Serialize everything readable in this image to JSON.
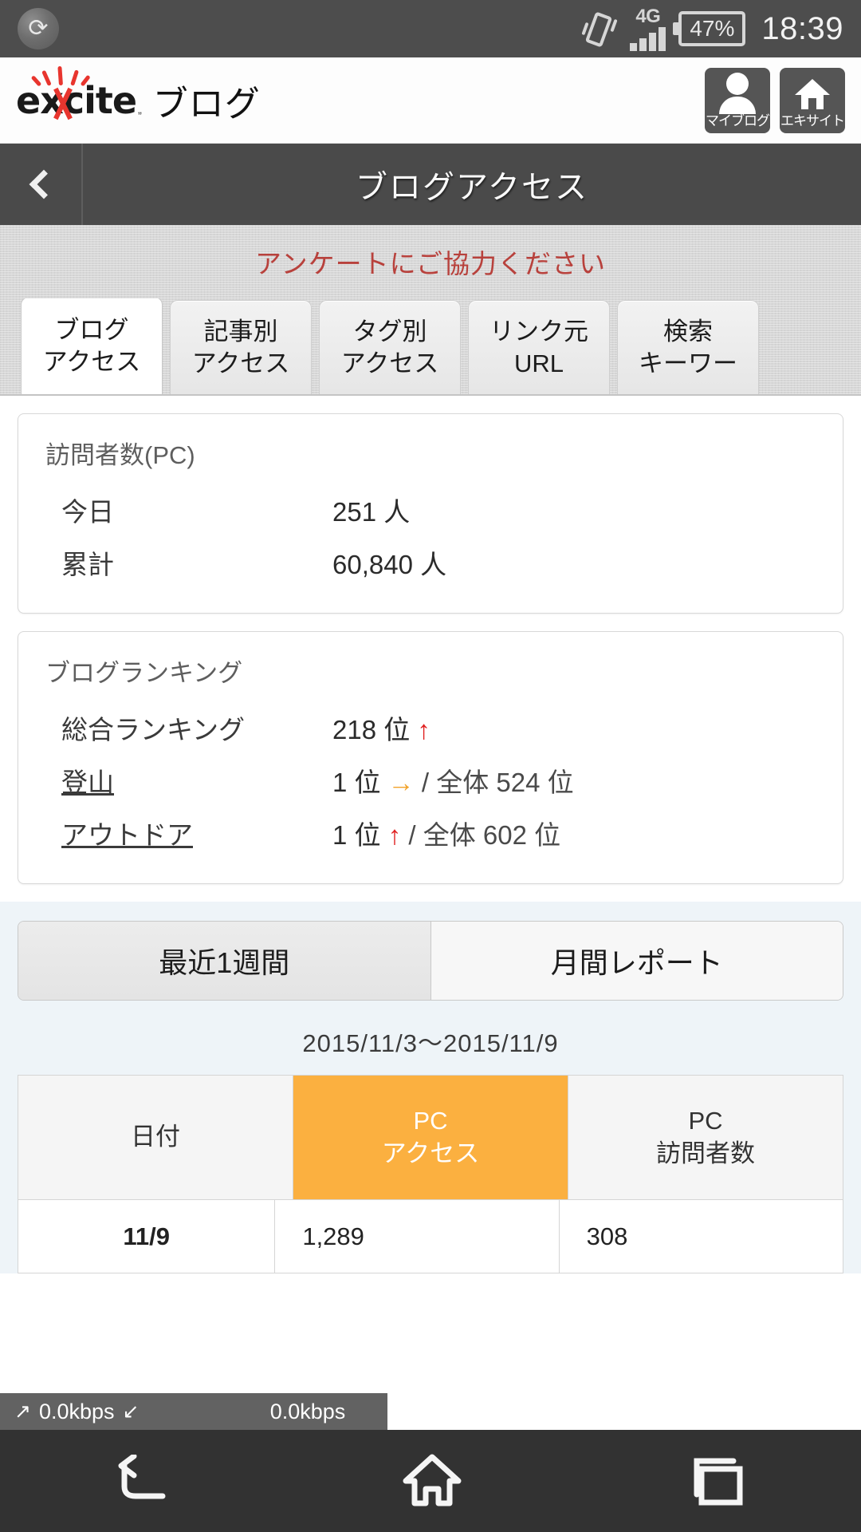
{
  "status_bar": {
    "logo_icon": "app-circle-icon",
    "vibrate_icon": "vibrate-icon",
    "network_type": "4G",
    "signal_icon": "signal-bars-icon",
    "battery_percent": "47%",
    "clock": "18:39"
  },
  "app_header": {
    "brand_name": "excite",
    "brand_tm": "TM",
    "brand_jp": "ブログ",
    "buttons": [
      {
        "icon": "person-icon",
        "label": "マイブログ"
      },
      {
        "icon": "home-icon",
        "label": "エキサイト"
      }
    ]
  },
  "nav_bar": {
    "back_icon": "chevron-left-icon",
    "title": "ブログアクセス"
  },
  "survey_banner": {
    "text": "アンケートにご協力ください"
  },
  "tabs": [
    {
      "line1": "ブログ",
      "line2": "アクセス",
      "active": true
    },
    {
      "line1": "記事別",
      "line2": "アクセス",
      "active": false
    },
    {
      "line1": "タグ別",
      "line2": "アクセス",
      "active": false
    },
    {
      "line1": "リンク元",
      "line2": "URL",
      "active": false
    },
    {
      "line1": "検索",
      "line2": "キーワー",
      "active": false
    }
  ],
  "visitors_card": {
    "title": "訪問者数(PC)",
    "rows": [
      {
        "label": "今日",
        "value": "251 人"
      },
      {
        "label": "累計",
        "value": "60,840 人"
      }
    ]
  },
  "ranking_card": {
    "title": "ブログランキング",
    "rows": [
      {
        "label": "総合ランキング",
        "is_link": false,
        "rank": "218 位",
        "trend": "up",
        "trend_glyph": "↑",
        "total": ""
      },
      {
        "label": "登山",
        "is_link": true,
        "rank": "1 位",
        "trend": "flat",
        "trend_glyph": "→",
        "total": "/ 全体 524 位"
      },
      {
        "label": "アウトドア",
        "is_link": true,
        "rank": "1 位",
        "trend": "up",
        "trend_glyph": "↑",
        "total": "/ 全体 602 位"
      }
    ]
  },
  "report_section": {
    "segments": [
      {
        "label": "最近1週間",
        "selected": true
      },
      {
        "label": "月間レポート",
        "selected": false
      }
    ],
    "date_range": "2015/11/3〜2015/11/9",
    "table": {
      "headers": [
        {
          "line1": "日付",
          "line2": "",
          "highlight": false
        },
        {
          "line1": "PC",
          "line2": "アクセス",
          "highlight": true
        },
        {
          "line1": "PC",
          "line2": "訪問者数",
          "highlight": false
        }
      ],
      "rows": [
        {
          "date": "11/9",
          "pc_access": "1,289",
          "pc_visitors": "308"
        }
      ]
    }
  },
  "network_overlay": {
    "up_icon": "arrow-up-right-icon",
    "up_speed": "0.0kbps",
    "down_icon": "arrow-down-left-icon",
    "down_speed": "0.0kbps"
  },
  "android_nav": {
    "back_icon": "back-arrow-icon",
    "home_icon": "home-icon",
    "recent_icon": "recent-apps-icon"
  },
  "colors": {
    "accent_orange": "#fbb040",
    "link_blue": "#1b83e0",
    "trend_up_red": "#e02020",
    "trend_flat_orange": "#f2a32a",
    "survey_red": "#b8413c",
    "navbar_dark": "#4a4a4a"
  },
  "chart_data": {
    "type": "table",
    "title": "2015/11/3〜2015/11/9",
    "columns": [
      "日付",
      "PC アクセス",
      "PC 訪問者数"
    ],
    "rows": [
      [
        "11/9",
        1289,
        308
      ]
    ]
  }
}
